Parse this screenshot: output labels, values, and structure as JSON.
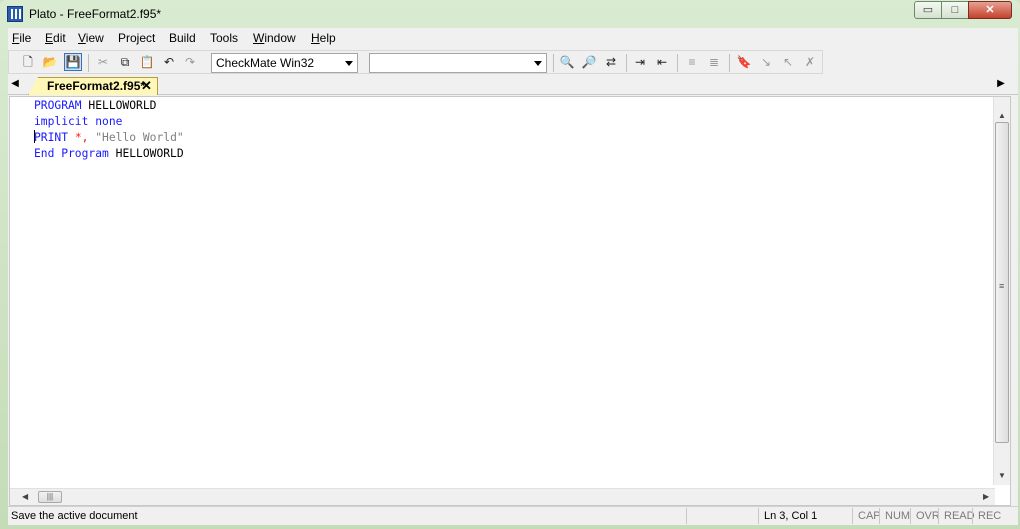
{
  "window": {
    "title": "Plato - FreeFormat2.f95*",
    "minimize_glyph": "▭",
    "maximize_glyph": "□",
    "close_glyph": "✕"
  },
  "menu": {
    "items": [
      {
        "first": "F",
        "rest": "ile"
      },
      {
        "first": "E",
        "rest": "dit"
      },
      {
        "first": "V",
        "rest": "iew"
      },
      {
        "first": "",
        "rest": "Project"
      },
      {
        "first": "",
        "rest": "Build"
      },
      {
        "first": "",
        "rest": "Tools"
      },
      {
        "first": "W",
        "rest": "indow"
      },
      {
        "first": "H",
        "rest": "elp"
      }
    ]
  },
  "toolbar": {
    "icons": {
      "new": "🗋",
      "open": "📂",
      "save": "💾",
      "cut": "✂",
      "copy": "⧉",
      "paste": "📋",
      "undo": "↶",
      "redo": "↷",
      "find": "🔍",
      "find_next": "🔎",
      "replace": "⇄",
      "indent": "⇥",
      "outdent": "⇤",
      "comment": "≡",
      "uncomment": "≣",
      "bookmark": "🔖",
      "bookmark_next": "↘",
      "bookmark_prev": "↖",
      "bookmark_clear": "✗"
    },
    "config_select": "CheckMate Win32",
    "target_select": ""
  },
  "tabs": {
    "left_arrow": "◀",
    "right_arrow": "▶",
    "active": {
      "label": "FreeFormat2.f95*",
      "close": "✕"
    }
  },
  "code": {
    "line1": {
      "kw": "PROGRAM",
      "id": "HELLOWORLD"
    },
    "line2": {
      "kw": "implicit none"
    },
    "line3": {
      "kw": "PRINT",
      "op": "*,",
      "str": "\"Hello World\""
    },
    "line4": {
      "kw": "End Program",
      "id": "HELLOWORLD"
    }
  },
  "scrollbars": {
    "up": "▲",
    "down": "▼",
    "left": "◀",
    "right": "▶",
    "v_grip": "≡",
    "h_grip": "|||"
  },
  "status": {
    "message": "Save the active document",
    "position": "Ln 3, Col 1",
    "caps": "CAP",
    "num": "NUM",
    "ovr": "OVR",
    "read": "READ",
    "rec": "REC"
  },
  "colors": {
    "keyword": "#1a1aff",
    "operator": "#ff1a1a",
    "string": "#808080",
    "tab_active": "#fff7b8"
  }
}
